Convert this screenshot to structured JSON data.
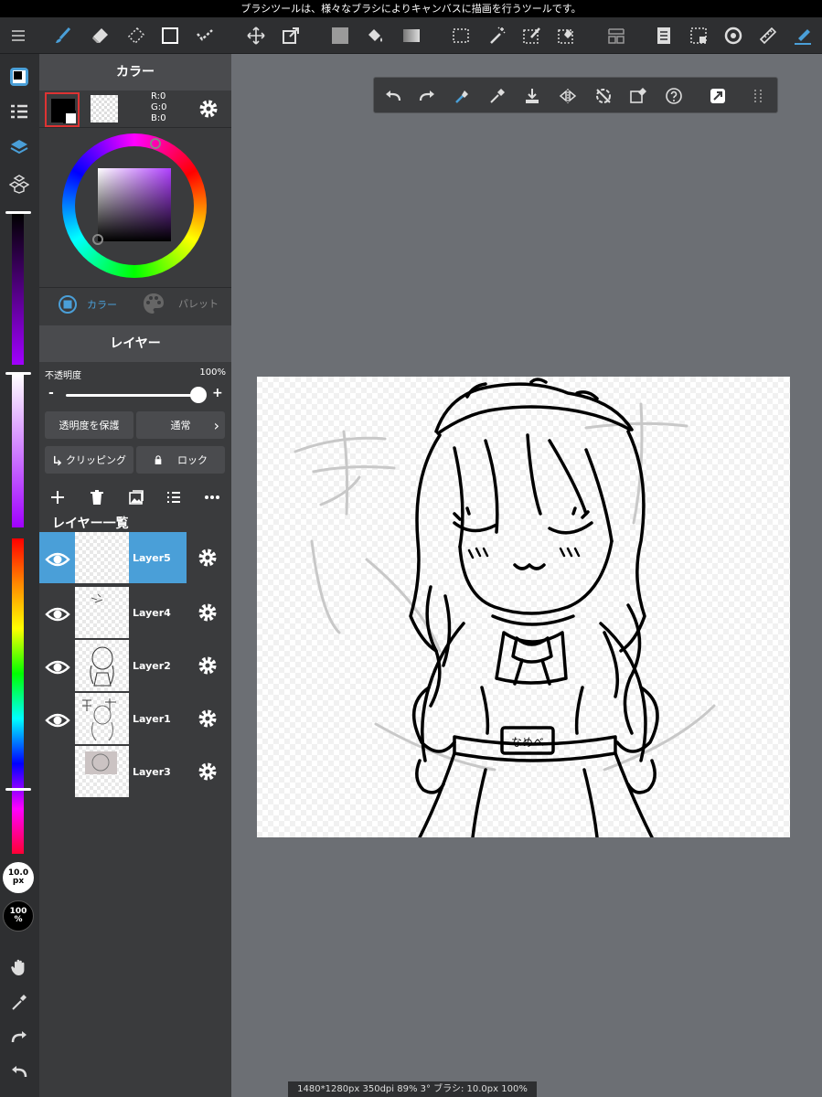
{
  "hint": "ブラシツールは、様々なブラシによりキャンバスに描画を行うツールです。",
  "toolbar": {
    "tools": [
      "menu-icon",
      "brush-icon",
      "eraser-icon",
      "blur-eraser-icon",
      "rect-shape-icon",
      "dot-tool-icon",
      "move-icon",
      "transform-icon",
      "fill-color-icon",
      "bucket-icon",
      "gradient-icon",
      "select-rect-icon",
      "magic-wand-icon",
      "select-pen-icon",
      "select-eraser-icon",
      "layout-icon",
      "page-icon",
      "select-dashed-icon",
      "rotate-icon",
      "ruler-icon",
      "pen-active-icon"
    ]
  },
  "color_panel": {
    "title": "カラー",
    "rgb_r": "R:0",
    "rgb_g": "G:0",
    "rgb_b": "B:0",
    "tab_color": "カラー",
    "tab_palette": "パレット",
    "accent": "#4a9fd8"
  },
  "layer_panel": {
    "title": "レイヤー",
    "opacity_label": "不透明度",
    "opacity_value": "100%",
    "opacity_fraction": 1.0,
    "minus": "-",
    "plus": "+",
    "protect_alpha": "透明度を保護",
    "blend_mode": "通常",
    "clipping": "クリッピング",
    "lock": "ロック",
    "list_title": "レイヤー一覧",
    "layers": [
      {
        "name": "Layer5",
        "visible": true,
        "selected": true
      },
      {
        "name": "Layer4",
        "visible": true,
        "selected": false
      },
      {
        "name": "Layer2",
        "visible": true,
        "selected": false
      },
      {
        "name": "Layer1",
        "visible": true,
        "selected": false
      },
      {
        "name": "Layer3",
        "visible": false,
        "selected": false
      }
    ]
  },
  "rail": {
    "brush_size_top": "10.0",
    "brush_size_bottom": "px",
    "opacity_top": "100",
    "opacity_bottom": "%"
  },
  "status": "1480*1280px 350dpi 89% 3° ブラシ: 10.0px 100%"
}
